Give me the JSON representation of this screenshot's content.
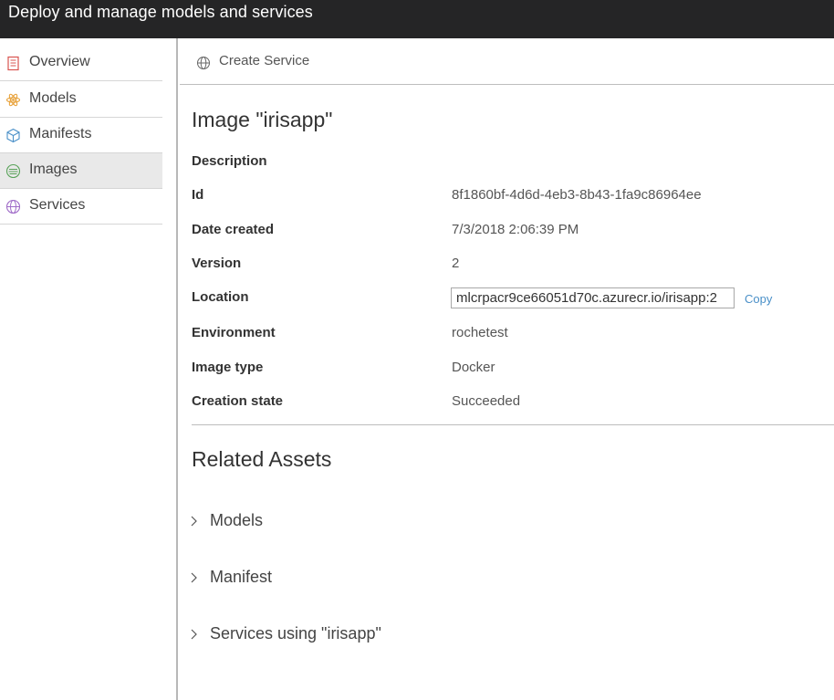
{
  "topbar": {
    "title": "Deploy and manage models and services"
  },
  "sidebar": {
    "items": [
      {
        "label": "Overview",
        "icon": "overview-icon",
        "active": false
      },
      {
        "label": "Models",
        "icon": "models-icon",
        "active": false
      },
      {
        "label": "Manifests",
        "icon": "manifests-icon",
        "active": false
      },
      {
        "label": "Images",
        "icon": "images-icon",
        "active": true
      },
      {
        "label": "Services",
        "icon": "services-icon",
        "active": false
      }
    ]
  },
  "toolbar": {
    "create_service_label": "Create Service",
    "create_service_icon": "globe-icon"
  },
  "image": {
    "title": "Image \"irisapp\"",
    "properties": {
      "description": {
        "label": "Description",
        "value": ""
      },
      "id": {
        "label": "Id",
        "value": "8f1860bf-4d6d-4eb3-8b43-1fa9c86964ee"
      },
      "date_created": {
        "label": "Date created",
        "value": "7/3/2018 2:06:39 PM"
      },
      "version": {
        "label": "Version",
        "value": "2"
      },
      "location": {
        "label": "Location",
        "value": "mlcrpacr9ce66051d70c.azurecr.io/irisapp:2",
        "copy_label": "Copy"
      },
      "environment": {
        "label": "Environment",
        "value": "rochetest"
      },
      "image_type": {
        "label": "Image type",
        "value": "Docker"
      },
      "creation_state": {
        "label": "Creation state",
        "value": "Succeeded"
      }
    }
  },
  "related": {
    "title": "Related Assets",
    "sections": [
      {
        "label": "Models"
      },
      {
        "label": "Manifest"
      },
      {
        "label": "Services using \"irisapp\""
      }
    ]
  },
  "colors": {
    "topbar_bg": "#252526",
    "active_nav_bg": "#e9e9e9",
    "link": "#4a90c8",
    "overview_icon": "#d9534f",
    "models_icon": "#e8a33d",
    "manifests_icon": "#4a90c8",
    "images_icon": "#5aa35a",
    "services_icon": "#a06cc8"
  }
}
